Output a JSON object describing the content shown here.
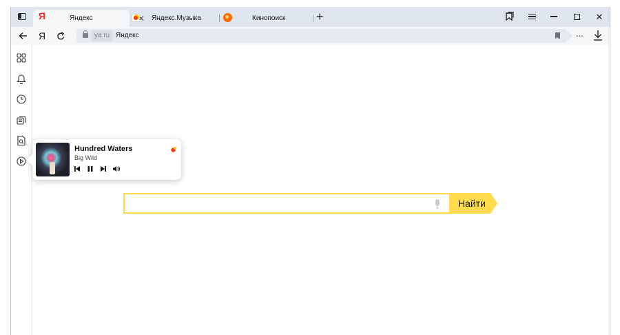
{
  "browser": {
    "tabs": [
      {
        "label": "Яндекс",
        "favicon": "yandex-logo-icon",
        "active": true
      },
      {
        "label": "Яндекс.Музыка",
        "favicon": "yandex-music-icon",
        "active": false
      },
      {
        "label": "Кинопоиск",
        "favicon": "kinopoisk-icon",
        "active": false
      }
    ],
    "address": {
      "domain": "ya.ru",
      "page_title": "Яндекс"
    },
    "toolbar": {
      "more_label": "..."
    }
  },
  "sidebar": {
    "icons": [
      "apps-grid-icon",
      "bell-icon",
      "clock-icon",
      "collections-icon",
      "search-page-icon",
      "play-circle-icon"
    ]
  },
  "player": {
    "title": "Hundred Waters",
    "artist": "Big Wild",
    "controls": [
      "prev-icon",
      "pause-icon",
      "next-icon",
      "volume-icon"
    ]
  },
  "search": {
    "button_label": "Найти",
    "value": ""
  },
  "colors": {
    "accent_yellow": "#ffdb4d",
    "titlebar": "#dee5ec",
    "yandex_red": "#f0322d"
  }
}
